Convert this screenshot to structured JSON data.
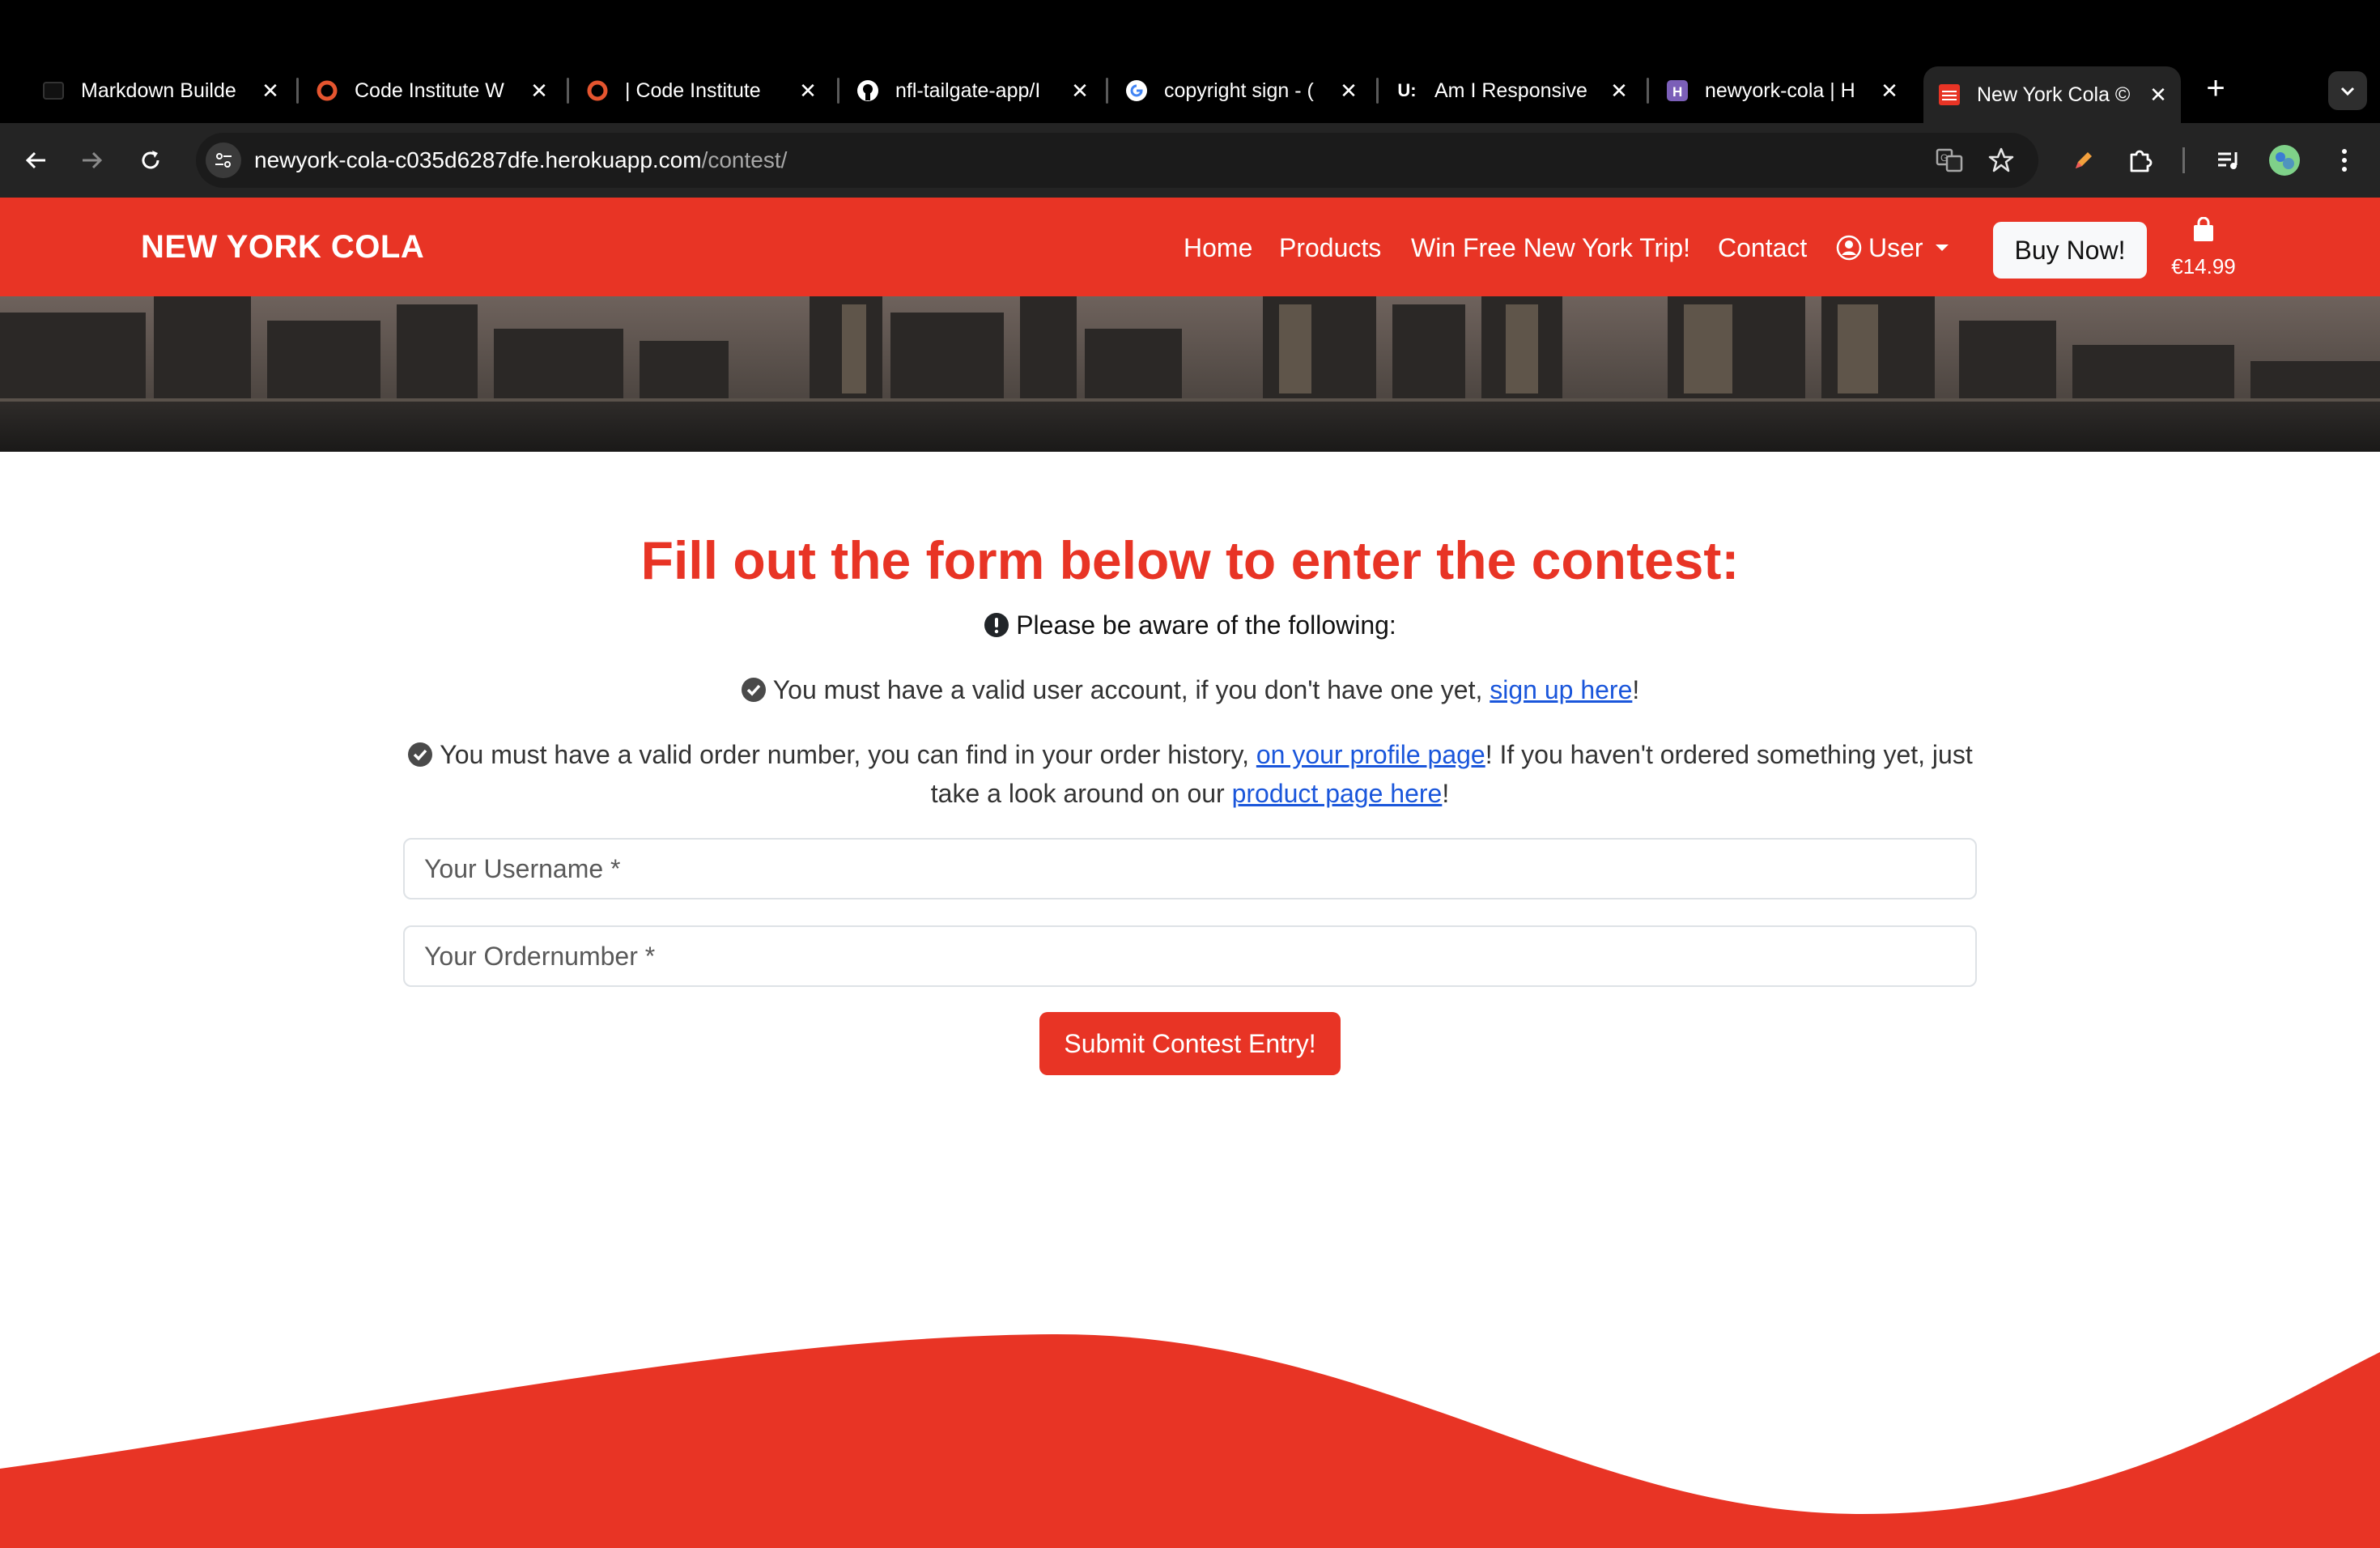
{
  "browser": {
    "tabs": [
      {
        "title": "Markdown Builde",
        "icon": "markdown-icon"
      },
      {
        "title": "Code Institute W",
        "icon": "code-institute-icon"
      },
      {
        "title": "| Code Institute",
        "icon": "code-institute-icon"
      },
      {
        "title": "nfl-tailgate-app/I",
        "icon": "github-icon"
      },
      {
        "title": "copyright sign - (",
        "icon": "google-icon"
      },
      {
        "title": "Am I Responsive",
        "icon": "am-i-responsive-icon"
      },
      {
        "title": "newyork-cola | H",
        "icon": "heroku-icon"
      },
      {
        "title": "New York Cola ©",
        "icon": "new-york-cola-icon",
        "active": true
      }
    ],
    "url_host": "newyork-cola-c035d6287dfe.herokuapp.com",
    "url_path": "/contest/"
  },
  "navbar": {
    "brand": "NEW YORK COLA",
    "links": [
      "Home",
      "Products",
      "Win Free New York Trip!",
      "Contact"
    ],
    "user_label": "User",
    "buy_now": "Buy Now!",
    "cart_total": "€14.99"
  },
  "contest": {
    "heading": "Fill out the form below to enter the contest:",
    "notice": "Please be aware of the following:",
    "requirement_1": {
      "text": "You must have a valid user account, if you don't have one yet,",
      "link": "sign up here",
      "suffix": "!"
    },
    "requirement_2": {
      "text": "You must have a valid order number, you can find in your order history,",
      "link_1": "on your profile page",
      "middle": "! If you haven't ordered something yet, just take a look around on our",
      "link_2": "product page here",
      "suffix": "!"
    },
    "username_placeholder": "Your Username *",
    "order_placeholder": "Your Ordernumber *",
    "submit_label": "Submit Contest Entry!"
  },
  "colors": {
    "brand_red": "#e83425",
    "link_blue": "#1a56db"
  }
}
